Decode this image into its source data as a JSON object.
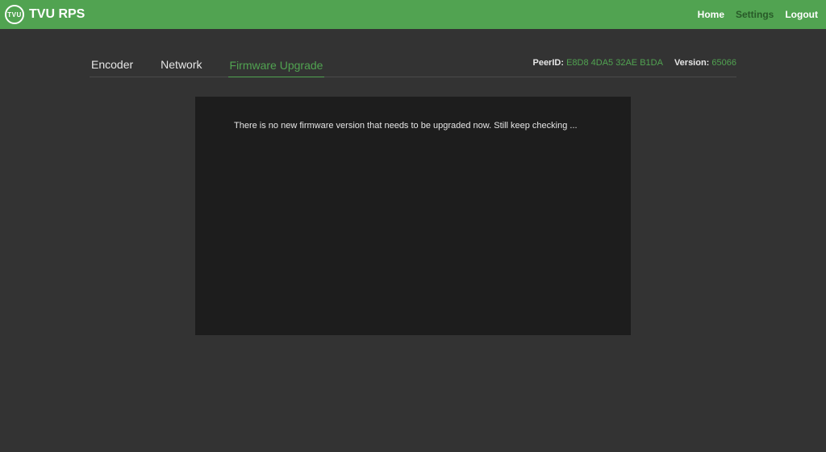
{
  "header": {
    "logo_text": "TVU",
    "title": "TVU RPS",
    "nav": {
      "home": "Home",
      "settings": "Settings",
      "logout": "Logout"
    }
  },
  "tabs": {
    "encoder": "Encoder",
    "network": "Network",
    "firmware": "Firmware Upgrade"
  },
  "meta": {
    "peerid_label": "PeerID:",
    "peerid_value": "E8D8 4DA5 32AE B1DA",
    "version_label": "Version:",
    "version_value": "65066"
  },
  "panel": {
    "message": "There is no new firmware version that needs to be upgraded now. Still keep checking ..."
  }
}
